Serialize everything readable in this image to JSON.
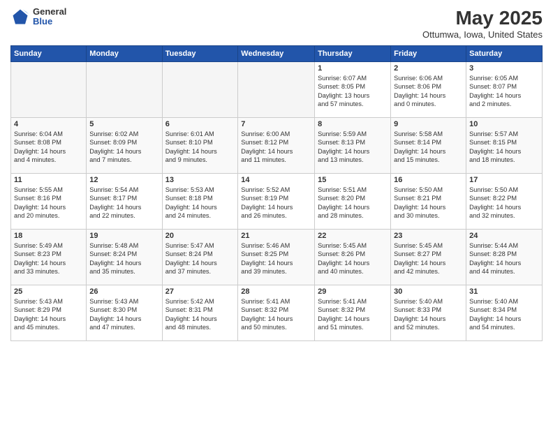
{
  "logo": {
    "general": "General",
    "blue": "Blue"
  },
  "header": {
    "title": "May 2025",
    "subtitle": "Ottumwa, Iowa, United States"
  },
  "days_of_week": [
    "Sunday",
    "Monday",
    "Tuesday",
    "Wednesday",
    "Thursday",
    "Friday",
    "Saturday"
  ],
  "weeks": [
    [
      {
        "day": "",
        "info": ""
      },
      {
        "day": "",
        "info": ""
      },
      {
        "day": "",
        "info": ""
      },
      {
        "day": "",
        "info": ""
      },
      {
        "day": "1",
        "info": "Sunrise: 6:07 AM\nSunset: 8:05 PM\nDaylight: 13 hours\nand 57 minutes."
      },
      {
        "day": "2",
        "info": "Sunrise: 6:06 AM\nSunset: 8:06 PM\nDaylight: 14 hours\nand 0 minutes."
      },
      {
        "day": "3",
        "info": "Sunrise: 6:05 AM\nSunset: 8:07 PM\nDaylight: 14 hours\nand 2 minutes."
      }
    ],
    [
      {
        "day": "4",
        "info": "Sunrise: 6:04 AM\nSunset: 8:08 PM\nDaylight: 14 hours\nand 4 minutes."
      },
      {
        "day": "5",
        "info": "Sunrise: 6:02 AM\nSunset: 8:09 PM\nDaylight: 14 hours\nand 7 minutes."
      },
      {
        "day": "6",
        "info": "Sunrise: 6:01 AM\nSunset: 8:10 PM\nDaylight: 14 hours\nand 9 minutes."
      },
      {
        "day": "7",
        "info": "Sunrise: 6:00 AM\nSunset: 8:12 PM\nDaylight: 14 hours\nand 11 minutes."
      },
      {
        "day": "8",
        "info": "Sunrise: 5:59 AM\nSunset: 8:13 PM\nDaylight: 14 hours\nand 13 minutes."
      },
      {
        "day": "9",
        "info": "Sunrise: 5:58 AM\nSunset: 8:14 PM\nDaylight: 14 hours\nand 15 minutes."
      },
      {
        "day": "10",
        "info": "Sunrise: 5:57 AM\nSunset: 8:15 PM\nDaylight: 14 hours\nand 18 minutes."
      }
    ],
    [
      {
        "day": "11",
        "info": "Sunrise: 5:55 AM\nSunset: 8:16 PM\nDaylight: 14 hours\nand 20 minutes."
      },
      {
        "day": "12",
        "info": "Sunrise: 5:54 AM\nSunset: 8:17 PM\nDaylight: 14 hours\nand 22 minutes."
      },
      {
        "day": "13",
        "info": "Sunrise: 5:53 AM\nSunset: 8:18 PM\nDaylight: 14 hours\nand 24 minutes."
      },
      {
        "day": "14",
        "info": "Sunrise: 5:52 AM\nSunset: 8:19 PM\nDaylight: 14 hours\nand 26 minutes."
      },
      {
        "day": "15",
        "info": "Sunrise: 5:51 AM\nSunset: 8:20 PM\nDaylight: 14 hours\nand 28 minutes."
      },
      {
        "day": "16",
        "info": "Sunrise: 5:50 AM\nSunset: 8:21 PM\nDaylight: 14 hours\nand 30 minutes."
      },
      {
        "day": "17",
        "info": "Sunrise: 5:50 AM\nSunset: 8:22 PM\nDaylight: 14 hours\nand 32 minutes."
      }
    ],
    [
      {
        "day": "18",
        "info": "Sunrise: 5:49 AM\nSunset: 8:23 PM\nDaylight: 14 hours\nand 33 minutes."
      },
      {
        "day": "19",
        "info": "Sunrise: 5:48 AM\nSunset: 8:24 PM\nDaylight: 14 hours\nand 35 minutes."
      },
      {
        "day": "20",
        "info": "Sunrise: 5:47 AM\nSunset: 8:24 PM\nDaylight: 14 hours\nand 37 minutes."
      },
      {
        "day": "21",
        "info": "Sunrise: 5:46 AM\nSunset: 8:25 PM\nDaylight: 14 hours\nand 39 minutes."
      },
      {
        "day": "22",
        "info": "Sunrise: 5:45 AM\nSunset: 8:26 PM\nDaylight: 14 hours\nand 40 minutes."
      },
      {
        "day": "23",
        "info": "Sunrise: 5:45 AM\nSunset: 8:27 PM\nDaylight: 14 hours\nand 42 minutes."
      },
      {
        "day": "24",
        "info": "Sunrise: 5:44 AM\nSunset: 8:28 PM\nDaylight: 14 hours\nand 44 minutes."
      }
    ],
    [
      {
        "day": "25",
        "info": "Sunrise: 5:43 AM\nSunset: 8:29 PM\nDaylight: 14 hours\nand 45 minutes."
      },
      {
        "day": "26",
        "info": "Sunrise: 5:43 AM\nSunset: 8:30 PM\nDaylight: 14 hours\nand 47 minutes."
      },
      {
        "day": "27",
        "info": "Sunrise: 5:42 AM\nSunset: 8:31 PM\nDaylight: 14 hours\nand 48 minutes."
      },
      {
        "day": "28",
        "info": "Sunrise: 5:41 AM\nSunset: 8:32 PM\nDaylight: 14 hours\nand 50 minutes."
      },
      {
        "day": "29",
        "info": "Sunrise: 5:41 AM\nSunset: 8:32 PM\nDaylight: 14 hours\nand 51 minutes."
      },
      {
        "day": "30",
        "info": "Sunrise: 5:40 AM\nSunset: 8:33 PM\nDaylight: 14 hours\nand 52 minutes."
      },
      {
        "day": "31",
        "info": "Sunrise: 5:40 AM\nSunset: 8:34 PM\nDaylight: 14 hours\nand 54 minutes."
      }
    ]
  ]
}
